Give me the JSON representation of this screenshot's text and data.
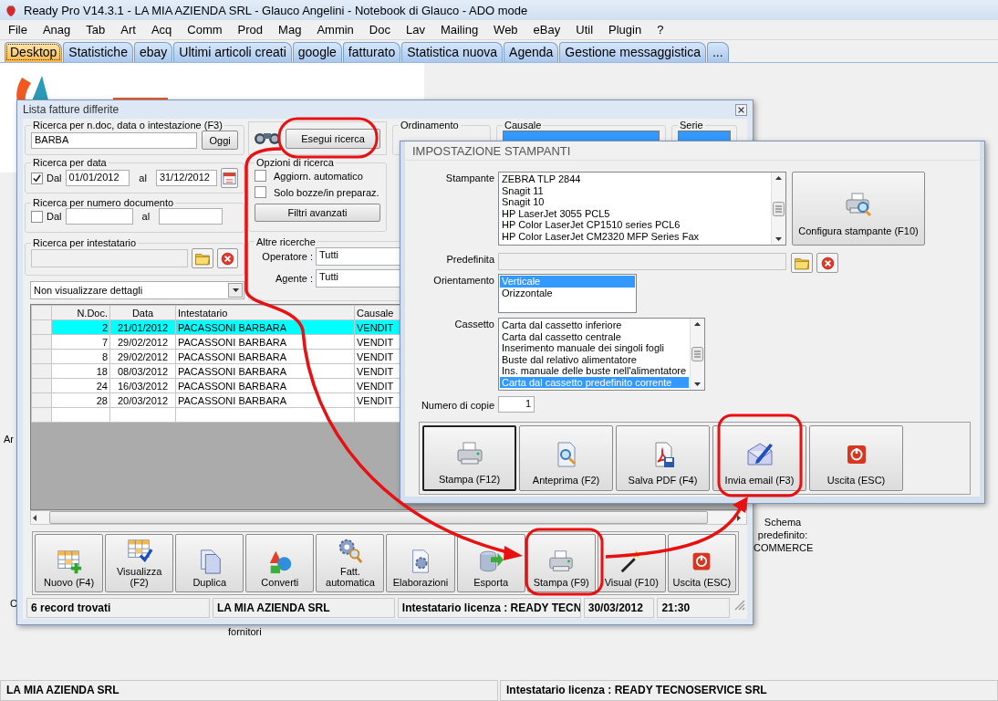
{
  "window": {
    "title": "Ready Pro V14.3.1 - LA MIA AZIENDA SRL - Glauco Angelini - Notebook di Glauco - ADO mode"
  },
  "menu": [
    "File",
    "Anag",
    "Tab",
    "Art",
    "Acq",
    "Comm",
    "Prod",
    "Mag",
    "Ammin",
    "Doc",
    "Lav",
    "Mailing",
    "Web",
    "eBay",
    "Util",
    "Plugin",
    "?"
  ],
  "tabs": [
    {
      "label": "Desktop",
      "selected": true
    },
    {
      "label": "Statistiche",
      "selected": false
    },
    {
      "label": "ebay",
      "selected": false
    },
    {
      "label": "Ultimi articoli creati",
      "selected": false
    },
    {
      "label": "google",
      "selected": false
    },
    {
      "label": "fatturato",
      "selected": false
    },
    {
      "label": "Statistica nuova",
      "selected": false
    },
    {
      "label": "Agenda",
      "selected": false
    },
    {
      "label": "Gestione messaggistica",
      "selected": false
    },
    {
      "label": "...",
      "selected": false
    }
  ],
  "desktop_labels": [
    "Ar",
    "C",
    "fornitori",
    "Schema predefinito: COMMERCE"
  ],
  "invoice_list": {
    "title": "Lista fatture differite",
    "search_text": {
      "legend": "Ricerca per n.doc, data o intestazione (F3)",
      "value": "BARBA",
      "button": "Oggi"
    },
    "search_button": "Esegui ricerca",
    "sort": {
      "legend": "Ordinamento"
    },
    "reason": {
      "legend": "Causale"
    },
    "series": {
      "legend": "Serie"
    },
    "date_search": {
      "legend": "Ricerca per data",
      "checked": true,
      "from_label": "Dal",
      "from": "01/01/2012",
      "to_label": "al",
      "to": "31/12/2012"
    },
    "number_search": {
      "legend": "Ricerca per numero documento",
      "checked": false,
      "from_label": "Dal",
      "to_label": "al"
    },
    "options": {
      "legend": "Opzioni di ricerca",
      "checks": [
        {
          "label": "Aggiorn. automatico",
          "checked": false
        },
        {
          "label": "Solo bozze/in preparaz.",
          "checked": false
        }
      ],
      "button": "Filtri avanzati"
    },
    "holder_search": {
      "legend": "Ricerca per intestatario"
    },
    "other_searches": {
      "legend": "Altre ricerche",
      "fields": [
        {
          "label": "Operatore :",
          "value": "Tutti"
        },
        {
          "label": "Agente :",
          "value": "Tutti"
        }
      ]
    },
    "detail_select": {
      "value": "Non visualizzare dettagli"
    },
    "table": {
      "columns": [
        "N.Doc.",
        "Data",
        "Intestatario",
        "Causale"
      ],
      "rows": [
        {
          "cells": [
            "2",
            "21/01/2012",
            "PACASSONI BARBARA",
            "VENDIT"
          ],
          "selected": true
        },
        {
          "cells": [
            "7",
            "29/02/2012",
            "PACASSONI BARBARA",
            "VENDIT"
          ],
          "selected": false
        },
        {
          "cells": [
            "8",
            "29/02/2012",
            "PACASSONI BARBARA",
            "VENDIT"
          ],
          "selected": false
        },
        {
          "cells": [
            "18",
            "08/03/2012",
            "PACASSONI BARBARA",
            "VENDIT"
          ],
          "selected": false
        },
        {
          "cells": [
            "24",
            "16/03/2012",
            "PACASSONI BARBARA",
            "VENDIT"
          ],
          "selected": false
        },
        {
          "cells": [
            "28",
            "20/03/2012",
            "PACASSONI BARBARA",
            "VENDIT"
          ],
          "selected": false
        }
      ]
    },
    "toolbar": [
      "Nuovo (F4)",
      "Visualizza (F2)",
      "Duplica",
      "Converti",
      "Fatt. automatica",
      "Elaborazioni",
      "Esporta",
      "Stampa (F9)",
      "Visual (F10)",
      "Uscita (ESC)"
    ],
    "status": [
      "6 record trovati",
      "LA MIA AZIENDA SRL",
      "Intestatario licenza : READY TECN",
      "30/03/2012",
      "21:30"
    ]
  },
  "printer_setup": {
    "title": "IMPOSTAZIONE STAMPANTI",
    "printer": {
      "label": "Stampante",
      "items": [
        {
          "text": "ZEBRA TLP 2844",
          "selected": false
        },
        {
          "text": "Snagit 11",
          "selected": false
        },
        {
          "text": "Snagit 10",
          "selected": false
        },
        {
          "text": "HP LaserJet 3055 PCL5",
          "selected": false
        },
        {
          "text": "HP Color LaserJet CP1510 series PCL6",
          "selected": false
        },
        {
          "text": "HP Color LaserJet CM2320 MFP Series Fax",
          "selected": false
        }
      ]
    },
    "configure_button": "Configura stampante (F10)",
    "default": {
      "label": "Predefinita"
    },
    "orientation": {
      "label": "Orientamento",
      "items": [
        {
          "text": "Verticale",
          "selected": true
        },
        {
          "text": "Orizzontale",
          "selected": false
        }
      ]
    },
    "tray": {
      "label": "Cassetto",
      "items": [
        {
          "text": "Carta dal cassetto inferiore",
          "selected": false
        },
        {
          "text": "Carta dal cassetto centrale",
          "selected": false
        },
        {
          "text": "Inserimento manuale dei singoli fogli",
          "selected": false
        },
        {
          "text": "Buste dal relativo alimentatore",
          "selected": false
        },
        {
          "text": "Ins. manuale delle buste nell'alimentatore",
          "selected": false
        },
        {
          "text": "Carta dal cassetto predefinito corrente",
          "selected": true
        }
      ]
    },
    "copies": {
      "label": "Numero di copie",
      "value": "1"
    },
    "buttons": [
      {
        "label": "Stampa (F12)",
        "default": true
      },
      {
        "label": "Anteprima (F2)",
        "default": false
      },
      {
        "label": "Salva PDF (F4)",
        "default": false
      },
      {
        "label": "Invia email (F3)",
        "default": false
      },
      {
        "label": "Uscita (ESC)",
        "default": false
      }
    ]
  },
  "status_bar": [
    "LA MIA AZIENDA SRL",
    "Intestatario licenza : READY TECNOSERVICE SRL"
  ]
}
